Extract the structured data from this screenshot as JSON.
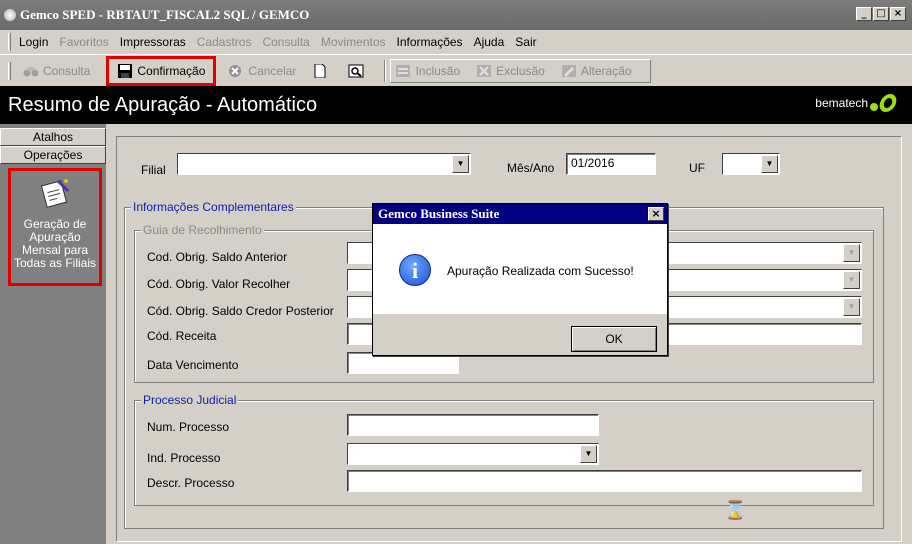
{
  "window": {
    "title": "Gemco SPED - RBTAUT_FISCAL2 SQL / GEMCO",
    "buttons": {
      "minimize": "_",
      "maximize": "□",
      "close": "×"
    }
  },
  "menu": {
    "items": [
      {
        "label": "Login",
        "enabled": true
      },
      {
        "label": "Favoritos",
        "enabled": false
      },
      {
        "label": "Impressoras",
        "enabled": true
      },
      {
        "label": "Cadastros",
        "enabled": false
      },
      {
        "label": "Consulta",
        "enabled": false
      },
      {
        "label": "Movimentos",
        "enabled": false
      },
      {
        "label": "Informações",
        "enabled": true
      },
      {
        "label": "Ajuda",
        "enabled": true
      },
      {
        "label": "Sair",
        "enabled": true
      }
    ]
  },
  "toolbar": {
    "consulta": "Consulta",
    "confirmacao": "Confirmação",
    "cancelar": "Cancelar",
    "inclusao": "Inclusão",
    "exclusao": "Exclusão",
    "alteracao": "Alteração"
  },
  "header": {
    "title": "Resumo de Apuração - Automático",
    "brand": "bematech"
  },
  "sidebar": {
    "atalhos": "Atalhos",
    "operacoes": "Operações",
    "item_label": "Geração de\nApuração\nMensal para\nTodas as Filiais"
  },
  "form": {
    "filial_label": "Filial",
    "filial_value": "",
    "mes_ano_label": "Mês/Ano",
    "mes_ano_value": "01/2016",
    "uf_label": "UF",
    "uf_value": "",
    "info_group": "Informações Complementares",
    "guia_group": "Guia de Recolhimento",
    "cod_saldo_anterior": "Cod. Obrig. Saldo Anterior",
    "cod_valor_recolher": "Cód. Obrig. Valor Recolher",
    "cod_saldo_credor": "Cód. Obrig. Saldo Credor Posterior",
    "cod_receita": "Cód. Receita",
    "data_vencimento": "Data Vencimento",
    "processo_group": "Processo Judicial",
    "num_processo": "Num. Processo",
    "ind_processo": "Ind. Processo",
    "descr_processo": "Descr. Processo"
  },
  "dialog": {
    "title": "Gemco Business Suite",
    "message": "Apuração Realizada com Sucesso!",
    "ok": "OK",
    "close": "×"
  },
  "cursor": {
    "symbol": "⌛"
  }
}
